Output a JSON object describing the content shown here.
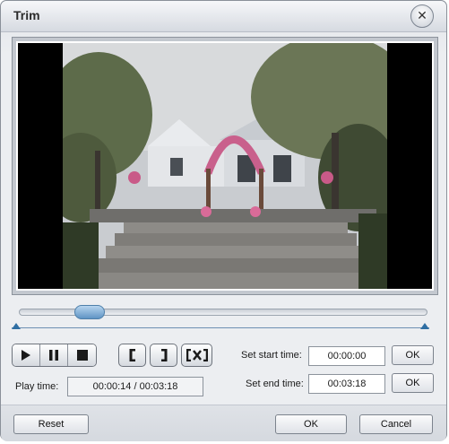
{
  "window": {
    "title": "Trim"
  },
  "icons": {
    "close": "close-icon",
    "play": "play-icon",
    "pause": "pause-icon",
    "stop": "stop-icon",
    "mark_in": "mark-in-icon",
    "mark_out": "mark-out-icon",
    "clear_marks": "clear-marks-icon"
  },
  "playback": {
    "play_time_label": "Play time:",
    "play_time_value": "00:00:14 / 00:03:18",
    "progress_fraction": 0.07
  },
  "trim": {
    "start_label": "Set start time:",
    "start_value": "00:00:00",
    "start_ok": "OK",
    "end_label": "Set end time:",
    "end_value": "00:03:18",
    "end_ok": "OK"
  },
  "footer": {
    "reset": "Reset",
    "ok": "OK",
    "cancel": "Cancel"
  },
  "colors": {
    "accent": "#5f94c4",
    "marker": "#2f6ea3"
  }
}
